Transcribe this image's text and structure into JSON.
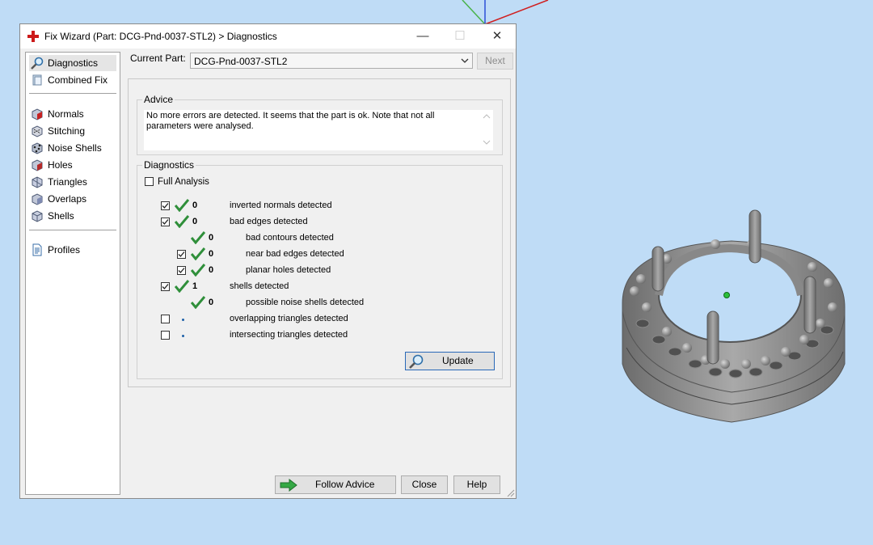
{
  "window": {
    "title": "Fix Wizard (Part: DCG-Pnd-0037-STL2) > Diagnostics",
    "minimize": "—",
    "maximize": "☐",
    "close": "✕"
  },
  "sidebar": {
    "items": [
      {
        "label": "Diagnostics",
        "icon": "magnifier-icon"
      },
      {
        "label": "Combined Fix",
        "icon": "combined-fix-icon"
      },
      {
        "label": "Normals",
        "icon": "normals-cube-icon"
      },
      {
        "label": "Stitching",
        "icon": "stitching-icon"
      },
      {
        "label": "Noise Shells",
        "icon": "noise-shells-icon"
      },
      {
        "label": "Holes",
        "icon": "holes-cube-icon"
      },
      {
        "label": "Triangles",
        "icon": "triangles-cube-icon"
      },
      {
        "label": "Overlaps",
        "icon": "overlaps-cube-icon"
      },
      {
        "label": "Shells",
        "icon": "shells-cube-icon"
      },
      {
        "label": "Profiles",
        "icon": "document-icon"
      }
    ]
  },
  "current_part": {
    "label": "Current Part:",
    "value": "DCG-Pnd-0037-STL2",
    "next_label": "Next"
  },
  "advice": {
    "title": "Advice",
    "text": "No more errors are detected. It seems that the part is ok. Note that not all parameters were analysed."
  },
  "diagnostics": {
    "title": "Diagnostics",
    "full_analysis": "Full Analysis",
    "rows": [
      {
        "count": "0",
        "label": "inverted normals detected"
      },
      {
        "count": "0",
        "label": "bad edges detected"
      },
      {
        "count": "0",
        "label": "bad contours detected"
      },
      {
        "count": "0",
        "label": "near bad edges detected"
      },
      {
        "count": "0",
        "label": "planar holes detected"
      },
      {
        "count": "1",
        "label": "shells detected"
      },
      {
        "count": "0",
        "label": "possible noise shells detected"
      },
      {
        "count": "",
        "label": "overlapping triangles detected"
      },
      {
        "count": "",
        "label": "intersecting triangles detected"
      }
    ],
    "update_label": "Update"
  },
  "footer": {
    "follow_advice": "Follow Advice",
    "close": "Close",
    "help": "Help"
  },
  "colors": {
    "accent": "#2a69b8",
    "check_green": "#2f8f3a",
    "background": "#bfdcf6",
    "model_gray": "#7b7b7b"
  }
}
